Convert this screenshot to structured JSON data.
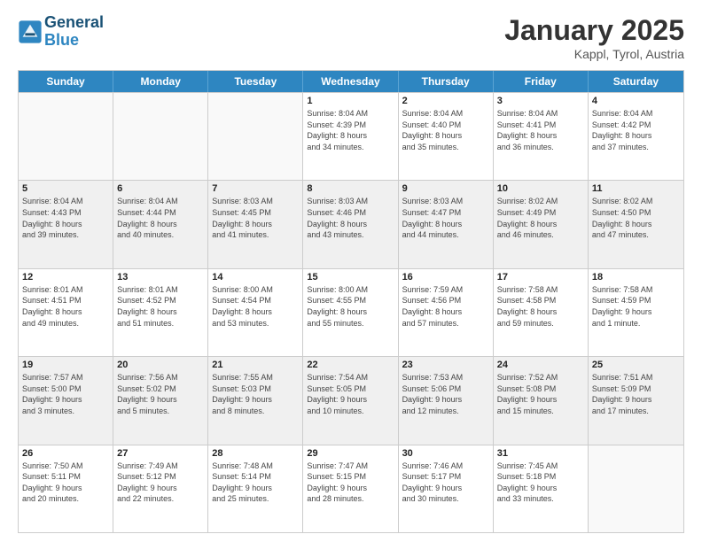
{
  "header": {
    "logo_line1": "General",
    "logo_line2": "Blue",
    "month": "January 2025",
    "location": "Kappl, Tyrol, Austria"
  },
  "weekdays": [
    "Sunday",
    "Monday",
    "Tuesday",
    "Wednesday",
    "Thursday",
    "Friday",
    "Saturday"
  ],
  "weeks": [
    [
      {
        "day": "",
        "info": "",
        "shaded": false,
        "empty": true
      },
      {
        "day": "",
        "info": "",
        "shaded": false,
        "empty": true
      },
      {
        "day": "",
        "info": "",
        "shaded": false,
        "empty": true
      },
      {
        "day": "1",
        "info": "Sunrise: 8:04 AM\nSunset: 4:39 PM\nDaylight: 8 hours\nand 34 minutes.",
        "shaded": false,
        "empty": false
      },
      {
        "day": "2",
        "info": "Sunrise: 8:04 AM\nSunset: 4:40 PM\nDaylight: 8 hours\nand 35 minutes.",
        "shaded": false,
        "empty": false
      },
      {
        "day": "3",
        "info": "Sunrise: 8:04 AM\nSunset: 4:41 PM\nDaylight: 8 hours\nand 36 minutes.",
        "shaded": false,
        "empty": false
      },
      {
        "day": "4",
        "info": "Sunrise: 8:04 AM\nSunset: 4:42 PM\nDaylight: 8 hours\nand 37 minutes.",
        "shaded": false,
        "empty": false
      }
    ],
    [
      {
        "day": "5",
        "info": "Sunrise: 8:04 AM\nSunset: 4:43 PM\nDaylight: 8 hours\nand 39 minutes.",
        "shaded": true,
        "empty": false
      },
      {
        "day": "6",
        "info": "Sunrise: 8:04 AM\nSunset: 4:44 PM\nDaylight: 8 hours\nand 40 minutes.",
        "shaded": true,
        "empty": false
      },
      {
        "day": "7",
        "info": "Sunrise: 8:03 AM\nSunset: 4:45 PM\nDaylight: 8 hours\nand 41 minutes.",
        "shaded": true,
        "empty": false
      },
      {
        "day": "8",
        "info": "Sunrise: 8:03 AM\nSunset: 4:46 PM\nDaylight: 8 hours\nand 43 minutes.",
        "shaded": true,
        "empty": false
      },
      {
        "day": "9",
        "info": "Sunrise: 8:03 AM\nSunset: 4:47 PM\nDaylight: 8 hours\nand 44 minutes.",
        "shaded": true,
        "empty": false
      },
      {
        "day": "10",
        "info": "Sunrise: 8:02 AM\nSunset: 4:49 PM\nDaylight: 8 hours\nand 46 minutes.",
        "shaded": true,
        "empty": false
      },
      {
        "day": "11",
        "info": "Sunrise: 8:02 AM\nSunset: 4:50 PM\nDaylight: 8 hours\nand 47 minutes.",
        "shaded": true,
        "empty": false
      }
    ],
    [
      {
        "day": "12",
        "info": "Sunrise: 8:01 AM\nSunset: 4:51 PM\nDaylight: 8 hours\nand 49 minutes.",
        "shaded": false,
        "empty": false
      },
      {
        "day": "13",
        "info": "Sunrise: 8:01 AM\nSunset: 4:52 PM\nDaylight: 8 hours\nand 51 minutes.",
        "shaded": false,
        "empty": false
      },
      {
        "day": "14",
        "info": "Sunrise: 8:00 AM\nSunset: 4:54 PM\nDaylight: 8 hours\nand 53 minutes.",
        "shaded": false,
        "empty": false
      },
      {
        "day": "15",
        "info": "Sunrise: 8:00 AM\nSunset: 4:55 PM\nDaylight: 8 hours\nand 55 minutes.",
        "shaded": false,
        "empty": false
      },
      {
        "day": "16",
        "info": "Sunrise: 7:59 AM\nSunset: 4:56 PM\nDaylight: 8 hours\nand 57 minutes.",
        "shaded": false,
        "empty": false
      },
      {
        "day": "17",
        "info": "Sunrise: 7:58 AM\nSunset: 4:58 PM\nDaylight: 8 hours\nand 59 minutes.",
        "shaded": false,
        "empty": false
      },
      {
        "day": "18",
        "info": "Sunrise: 7:58 AM\nSunset: 4:59 PM\nDaylight: 9 hours\nand 1 minute.",
        "shaded": false,
        "empty": false
      }
    ],
    [
      {
        "day": "19",
        "info": "Sunrise: 7:57 AM\nSunset: 5:00 PM\nDaylight: 9 hours\nand 3 minutes.",
        "shaded": true,
        "empty": false
      },
      {
        "day": "20",
        "info": "Sunrise: 7:56 AM\nSunset: 5:02 PM\nDaylight: 9 hours\nand 5 minutes.",
        "shaded": true,
        "empty": false
      },
      {
        "day": "21",
        "info": "Sunrise: 7:55 AM\nSunset: 5:03 PM\nDaylight: 9 hours\nand 8 minutes.",
        "shaded": true,
        "empty": false
      },
      {
        "day": "22",
        "info": "Sunrise: 7:54 AM\nSunset: 5:05 PM\nDaylight: 9 hours\nand 10 minutes.",
        "shaded": true,
        "empty": false
      },
      {
        "day": "23",
        "info": "Sunrise: 7:53 AM\nSunset: 5:06 PM\nDaylight: 9 hours\nand 12 minutes.",
        "shaded": true,
        "empty": false
      },
      {
        "day": "24",
        "info": "Sunrise: 7:52 AM\nSunset: 5:08 PM\nDaylight: 9 hours\nand 15 minutes.",
        "shaded": true,
        "empty": false
      },
      {
        "day": "25",
        "info": "Sunrise: 7:51 AM\nSunset: 5:09 PM\nDaylight: 9 hours\nand 17 minutes.",
        "shaded": true,
        "empty": false
      }
    ],
    [
      {
        "day": "26",
        "info": "Sunrise: 7:50 AM\nSunset: 5:11 PM\nDaylight: 9 hours\nand 20 minutes.",
        "shaded": false,
        "empty": false
      },
      {
        "day": "27",
        "info": "Sunrise: 7:49 AM\nSunset: 5:12 PM\nDaylight: 9 hours\nand 22 minutes.",
        "shaded": false,
        "empty": false
      },
      {
        "day": "28",
        "info": "Sunrise: 7:48 AM\nSunset: 5:14 PM\nDaylight: 9 hours\nand 25 minutes.",
        "shaded": false,
        "empty": false
      },
      {
        "day": "29",
        "info": "Sunrise: 7:47 AM\nSunset: 5:15 PM\nDaylight: 9 hours\nand 28 minutes.",
        "shaded": false,
        "empty": false
      },
      {
        "day": "30",
        "info": "Sunrise: 7:46 AM\nSunset: 5:17 PM\nDaylight: 9 hours\nand 30 minutes.",
        "shaded": false,
        "empty": false
      },
      {
        "day": "31",
        "info": "Sunrise: 7:45 AM\nSunset: 5:18 PM\nDaylight: 9 hours\nand 33 minutes.",
        "shaded": false,
        "empty": false
      },
      {
        "day": "",
        "info": "",
        "shaded": false,
        "empty": true
      }
    ]
  ]
}
